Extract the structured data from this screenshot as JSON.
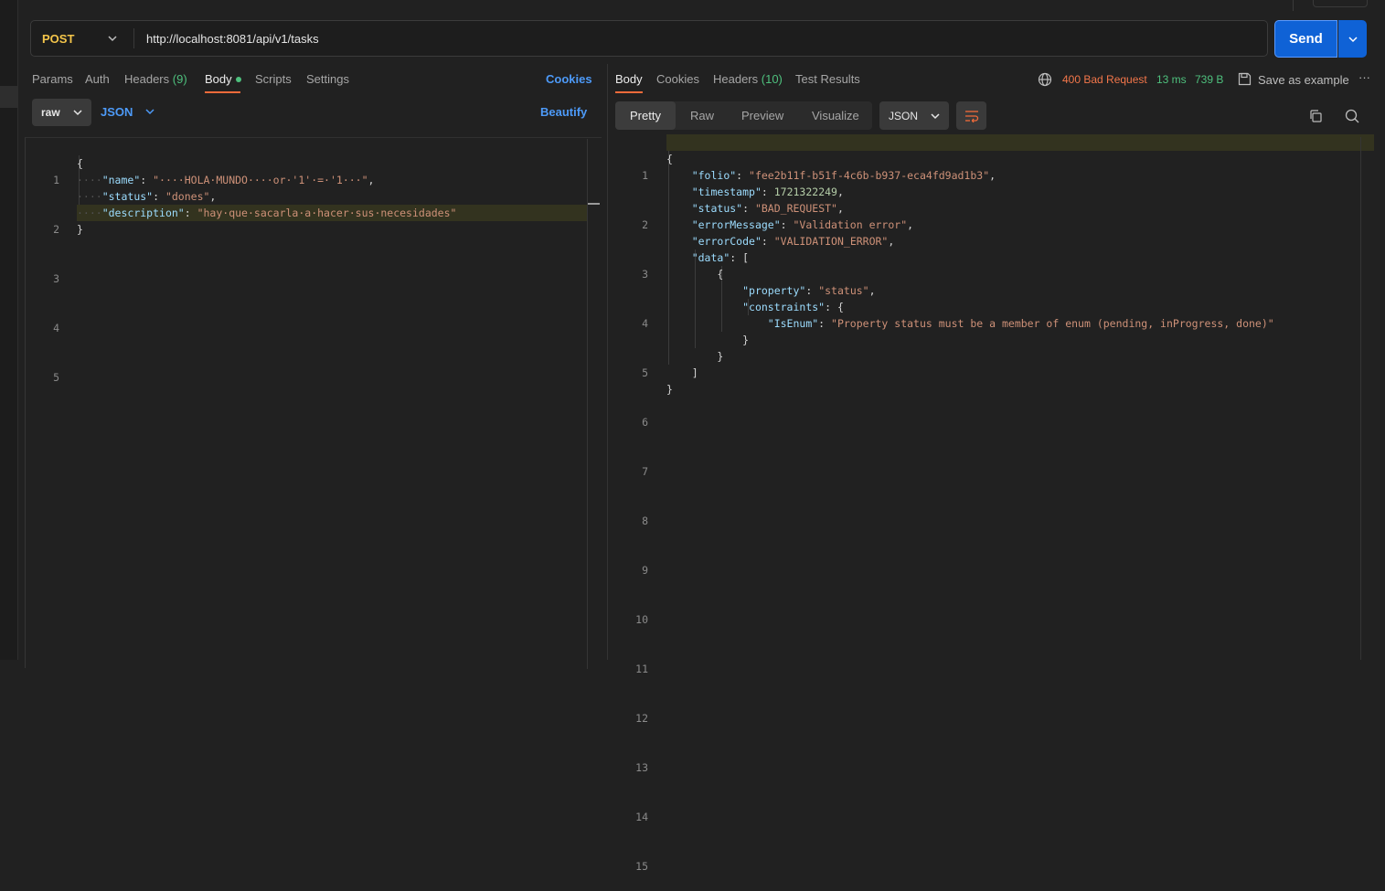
{
  "request": {
    "method": "POST",
    "url": "http://localhost:8081/api/v1/tasks",
    "send_label": "Send",
    "tabs": [
      {
        "label": "Params"
      },
      {
        "label": "Auth"
      },
      {
        "label": "Headers",
        "count": "(9)"
      },
      {
        "label": "Body"
      },
      {
        "label": "Scripts"
      },
      {
        "label": "Settings"
      }
    ],
    "cookies_label": "Cookies",
    "body_mode": "raw",
    "body_format": "JSON",
    "beautify_label": "Beautify",
    "line_numbers": [
      "1",
      "2",
      "3",
      "4",
      "5"
    ],
    "code": {
      "open": "{",
      "close": "}",
      "name_key": "\"name\"",
      "name_val": "\"····HOLA·MUNDO····or·'1'·=·'1···\"",
      "status_key": "\"status\"",
      "status_val": "\"dones\"",
      "description_key": "\"description\"",
      "description_val": "\"hay·que·sacarla·a·hacer·sus·necesidades\""
    }
  },
  "response": {
    "tabs": [
      {
        "label": "Body"
      },
      {
        "label": "Cookies"
      },
      {
        "label": "Headers",
        "count": "(10)"
      },
      {
        "label": "Test Results"
      }
    ],
    "status": "400 Bad Request",
    "time": "13 ms",
    "size": "739 B",
    "save_label": "Save as example",
    "views": [
      "Pretty",
      "Raw",
      "Preview",
      "Visualize"
    ],
    "format": "JSON",
    "line_numbers": [
      "1",
      "2",
      "3",
      "4",
      "5",
      "6",
      "7",
      "8",
      "9",
      "10",
      "11",
      "12",
      "13",
      "14",
      "15"
    ],
    "code": {
      "folio_key": "\"folio\"",
      "folio_val": "\"fee2b11f-b51f-4c6b-b937-eca4fd9ad1b3\"",
      "timestamp_key": "\"timestamp\"",
      "timestamp_val": "1721322249",
      "status_key": "\"status\"",
      "status_val": "\"BAD_REQUEST\"",
      "errorMessage_key": "\"errorMessage\"",
      "errorMessage_val": "\"Validation error\"",
      "errorCode_key": "\"errorCode\"",
      "errorCode_val": "\"VALIDATION_ERROR\"",
      "data_key": "\"data\"",
      "property_key": "\"property\"",
      "property_val": "\"status\"",
      "constraints_key": "\"constraints\"",
      "isEnum_key": "\"IsEnum\"",
      "isEnum_val": "\"Property status must be a member of enum (pending, inProgress, done)\""
    }
  }
}
